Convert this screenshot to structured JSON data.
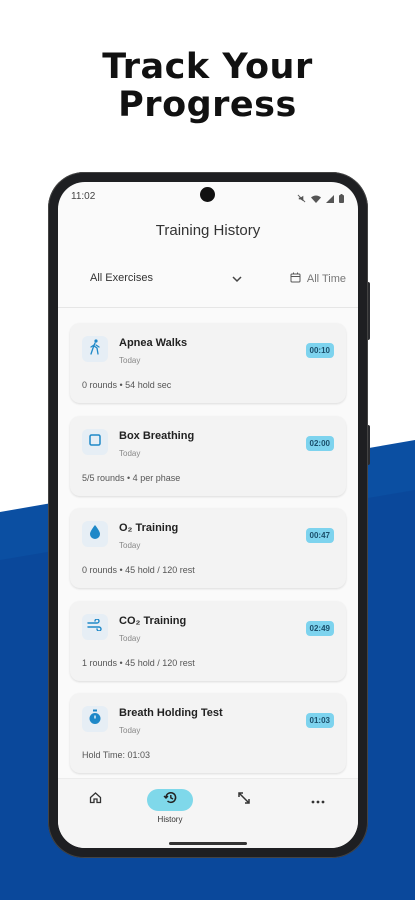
{
  "headline": {
    "line1": "Track Your",
    "line2": "Progress"
  },
  "colors": {
    "brand_blue": "#0b4fa2",
    "accent_cyan": "#7dd3ee",
    "icon_blue": "#1e88c8"
  },
  "status_bar": {
    "time": "11:02"
  },
  "screen": {
    "title": "Training History"
  },
  "filters": {
    "exercise": "All Exercises",
    "time_range": "All Time"
  },
  "sessions": [
    {
      "title": "Apnea Walks",
      "date": "Today",
      "duration": "00:10",
      "detail": "0 rounds • 54 hold sec",
      "icon": "walking-icon"
    },
    {
      "title": "Box Breathing",
      "date": "Today",
      "duration": "02:00",
      "detail": "5/5 rounds • 4 per phase",
      "icon": "square-icon"
    },
    {
      "title": "O₂ Training",
      "date": "Today",
      "duration": "00:47",
      "detail": "0 rounds • 45 hold / 120 rest",
      "icon": "water-drop-icon"
    },
    {
      "title": "CO₂ Training",
      "date": "Today",
      "duration": "02:49",
      "detail": "1 rounds • 45 hold / 120 rest",
      "icon": "wind-icon"
    },
    {
      "title": "Breath Holding Test",
      "date": "Today",
      "duration": "01:03",
      "detail": "Hold Time: 01:03",
      "icon": "stopwatch-icon"
    }
  ],
  "bottom_nav": {
    "history_label": "History"
  }
}
